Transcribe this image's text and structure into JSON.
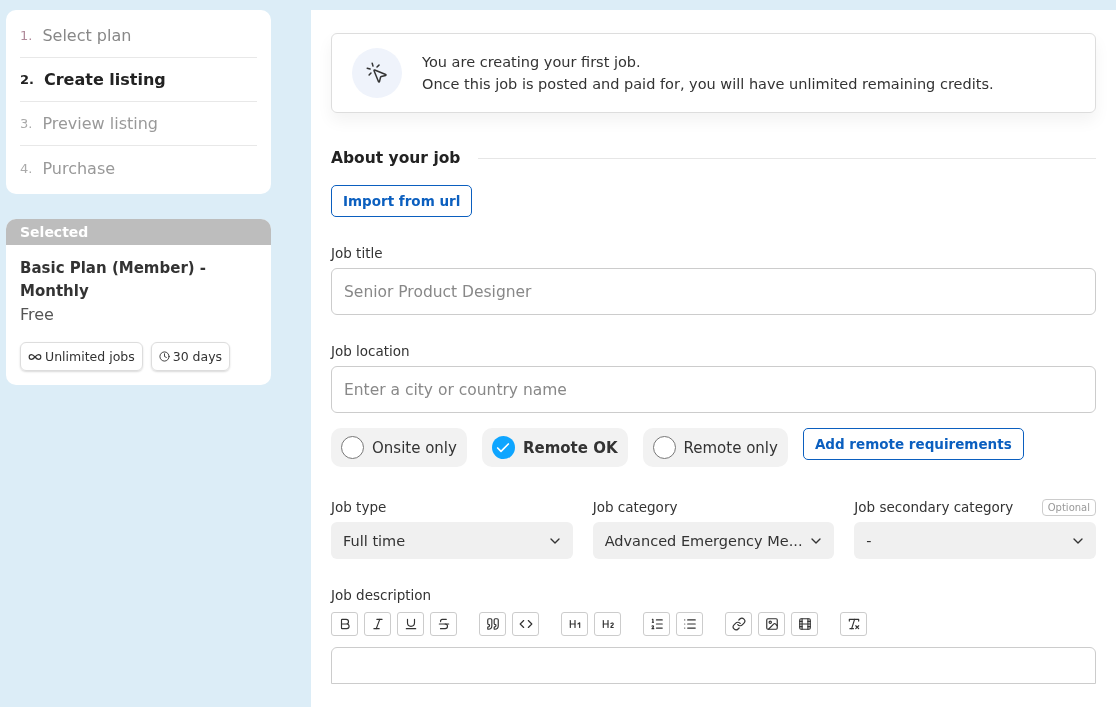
{
  "steps": [
    {
      "number": "1.",
      "label": "Select plan",
      "selected": false,
      "completed": true
    },
    {
      "number": "2.",
      "label": "Create listing",
      "selected": true,
      "completed": false
    },
    {
      "number": "3.",
      "label": "Preview listing",
      "selected": false,
      "completed": false
    },
    {
      "number": "4.",
      "label": "Purchase",
      "selected": false,
      "completed": false
    }
  ],
  "plan": {
    "header": "Selected",
    "name": "Basic Plan (Member) - Monthly",
    "price": "Free",
    "tags": [
      {
        "kind": "infinity",
        "label": "Unlimited jobs"
      },
      {
        "kind": "clock",
        "label": "30 days"
      }
    ]
  },
  "notice": {
    "title": "You are creating your first job.",
    "text": "Once this job is posted and paid for, you will have unlimited remaining credits."
  },
  "section_title": "About your job",
  "import_button": "Import from url",
  "job_title": {
    "label": "Job title",
    "placeholder": "Senior Product Designer"
  },
  "job_location": {
    "label": "Job location",
    "placeholder": "Enter a city or country name"
  },
  "remote_options": [
    {
      "label": "Onsite only",
      "selected": false
    },
    {
      "label": "Remote OK",
      "selected": true
    },
    {
      "label": "Remote only",
      "selected": false
    }
  ],
  "remote_button": "Add remote requirements",
  "selects": [
    {
      "label": "Job type",
      "value": "Full time"
    },
    {
      "label": "Job category",
      "value": "Advanced Emergency Me..."
    },
    {
      "label": "Job secondary category",
      "value": "-",
      "badge": "Optional"
    }
  ],
  "description": {
    "label": "Job description",
    "toolbar": [
      {
        "buttons": [
          {
            "kind": "bold"
          },
          {
            "kind": "italic"
          },
          {
            "kind": "underline"
          },
          {
            "kind": "strike"
          }
        ]
      },
      {
        "buttons": [
          {
            "kind": "quote"
          },
          {
            "kind": "code"
          }
        ]
      },
      {
        "buttons": [
          {
            "kind": "h1"
          },
          {
            "kind": "h2"
          }
        ]
      },
      {
        "buttons": [
          {
            "kind": "ordered"
          },
          {
            "kind": "bullets"
          }
        ]
      },
      {
        "buttons": [
          {
            "kind": "link"
          },
          {
            "kind": "image"
          },
          {
            "kind": "video"
          }
        ]
      },
      {
        "buttons": [
          {
            "kind": "clear"
          }
        ]
      }
    ]
  }
}
